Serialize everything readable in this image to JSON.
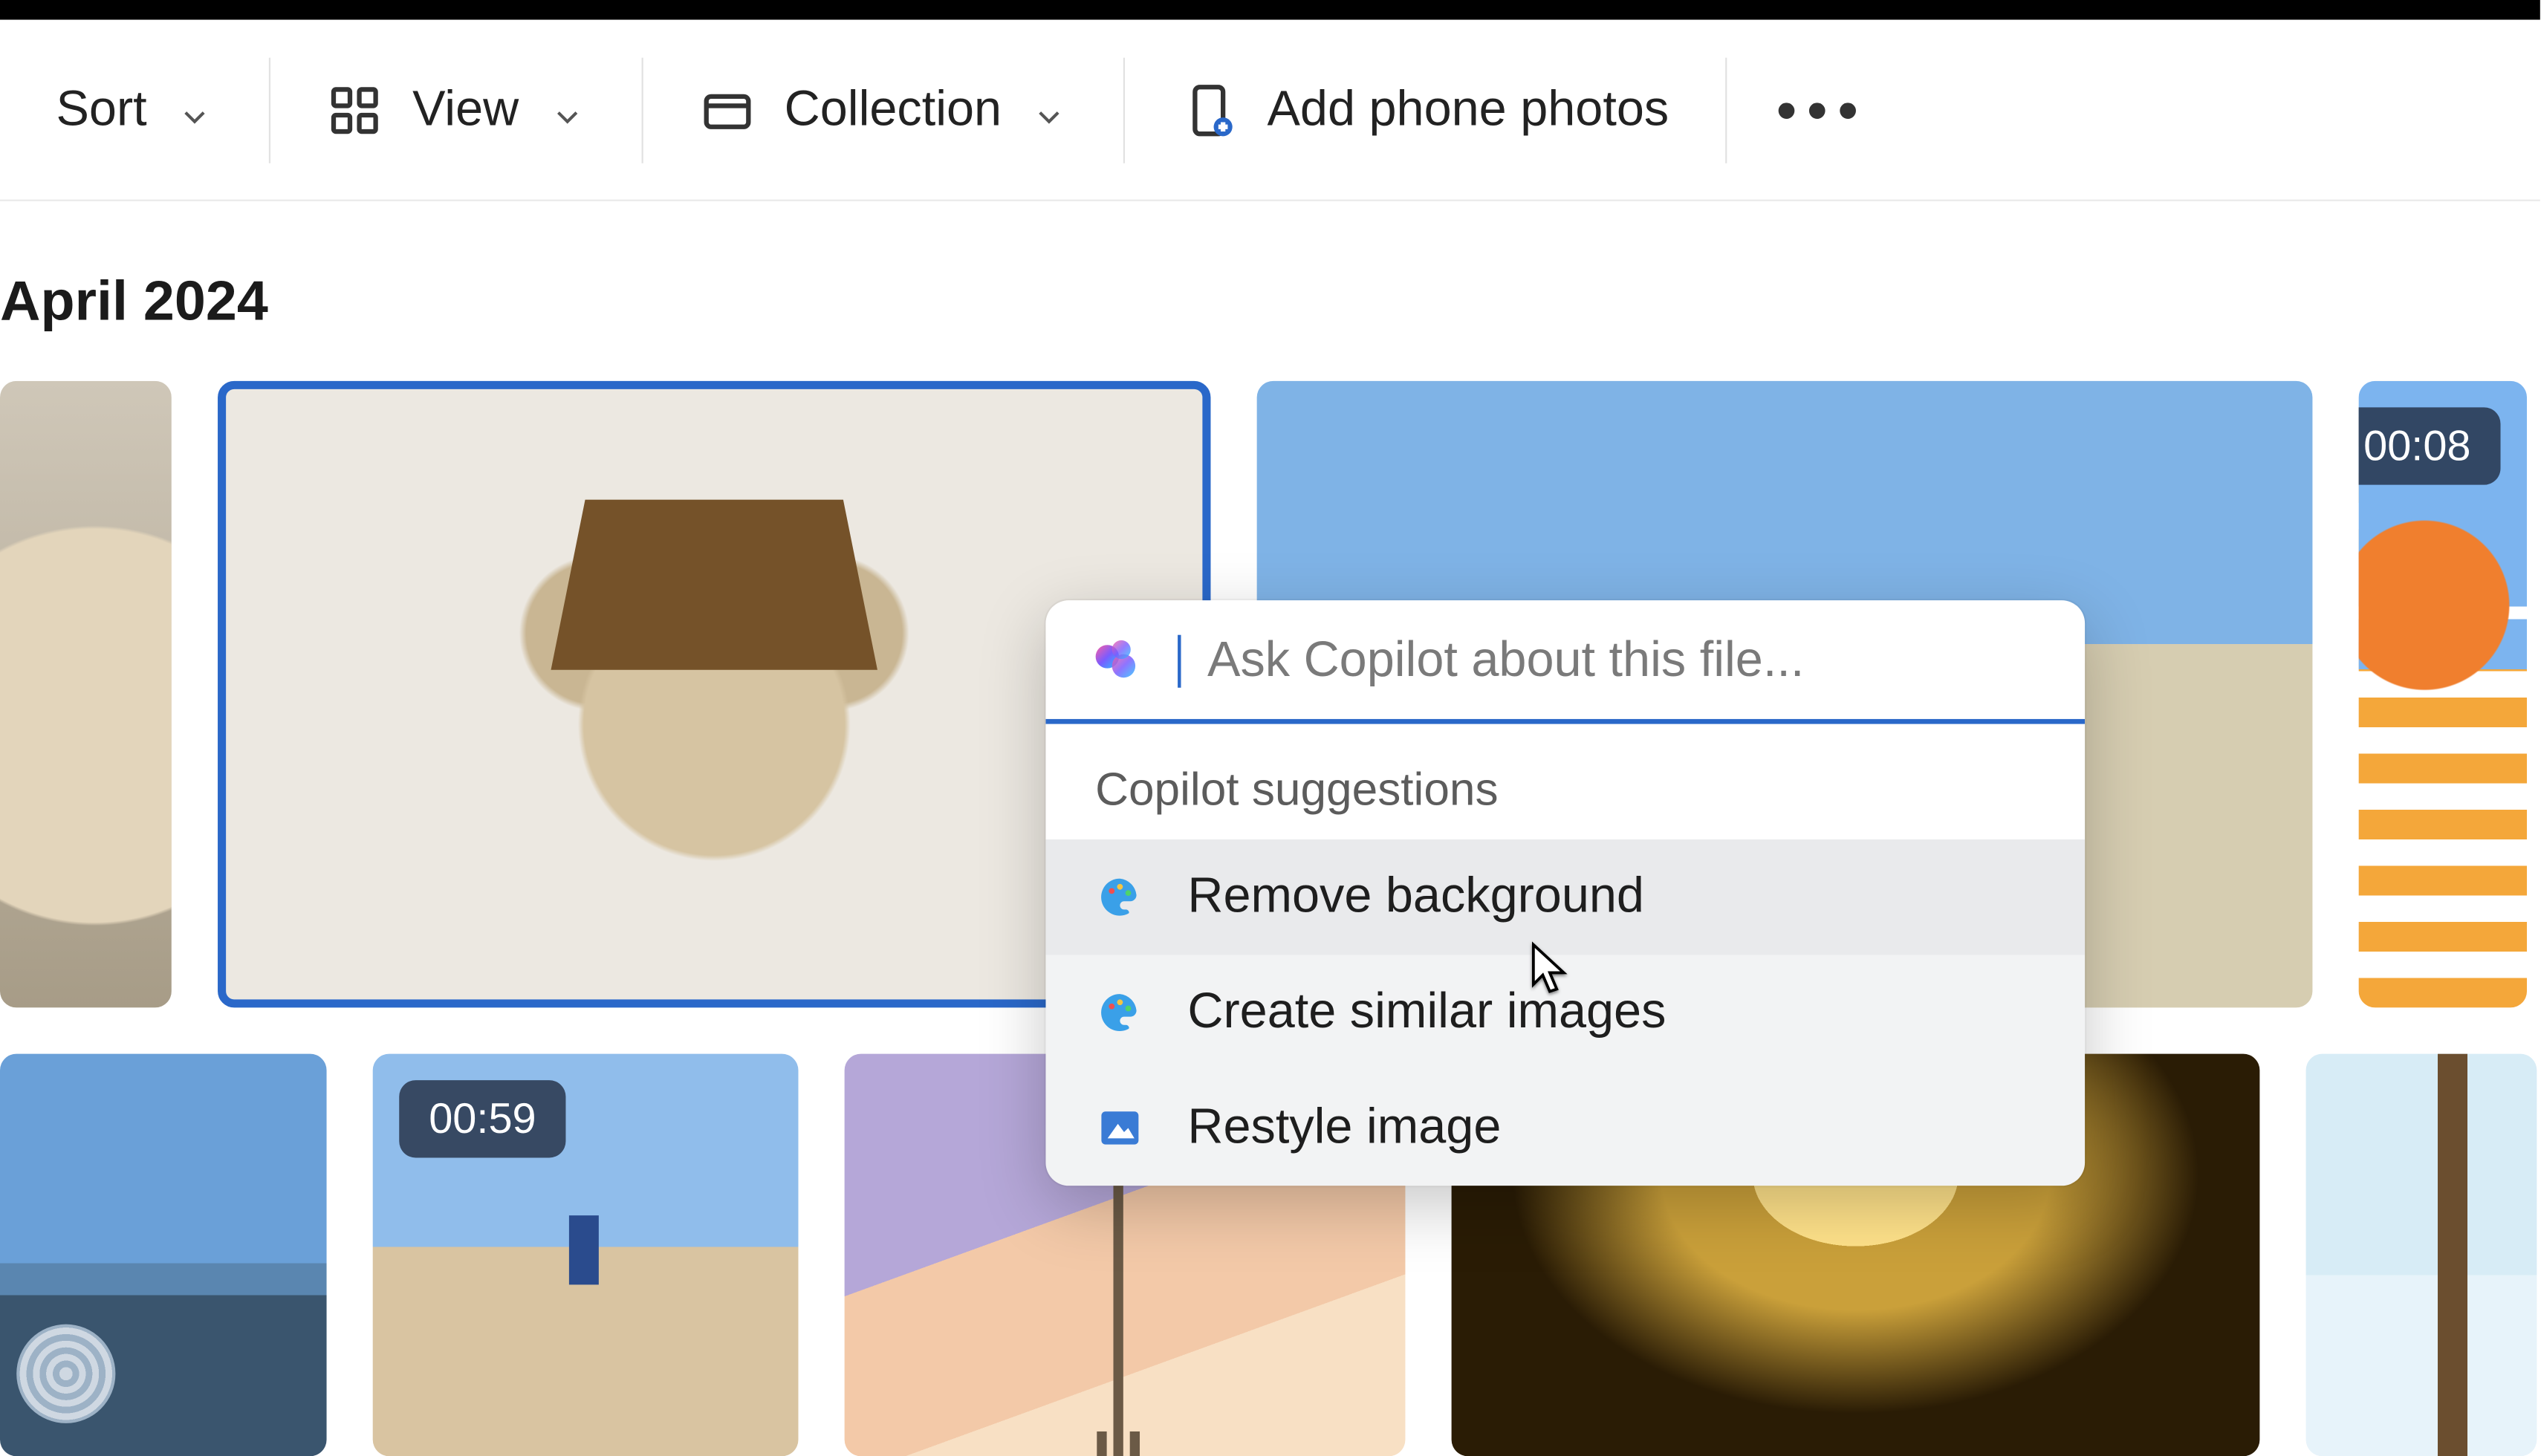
{
  "toolbar": {
    "sort_label": "Sort",
    "view_label": "View",
    "collection_label": "Collection",
    "add_phone_label": "Add phone photos",
    "more_label": "•••"
  },
  "section": {
    "title": "April 2024"
  },
  "thumbs": {
    "row1": [
      {
        "name": "fluffy-dog-crop"
      },
      {
        "name": "small-dog-on-chair",
        "selected": true
      },
      {
        "name": "desert-house"
      },
      {
        "name": "orange-structure-video",
        "duration": "00:08"
      }
    ],
    "row2": [
      {
        "name": "city-domes"
      },
      {
        "name": "hiker-rocks-video",
        "duration": "00:59"
      },
      {
        "name": "eiffel-sunset"
      },
      {
        "name": "concert-lights"
      },
      {
        "name": "palm-trees"
      }
    ]
  },
  "copilot": {
    "placeholder": "Ask Copilot about this file...",
    "section_label": "Copilot suggestions",
    "suggestions": [
      {
        "icon": "palette-icon",
        "label": "Remove background"
      },
      {
        "icon": "palette-icon",
        "label": "Create similar images"
      },
      {
        "icon": "photo-icon",
        "label": "Restyle image"
      }
    ]
  }
}
